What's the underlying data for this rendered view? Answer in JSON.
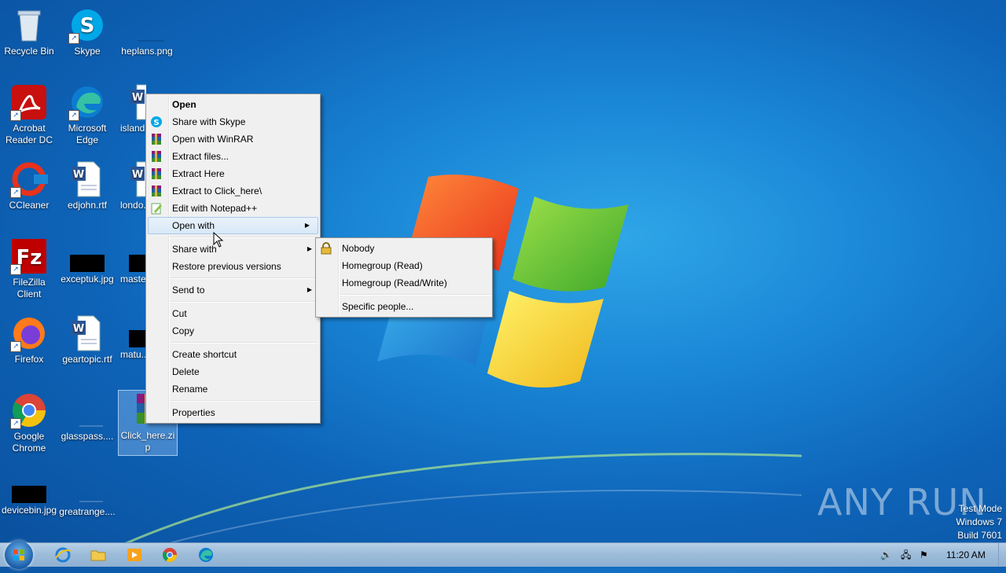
{
  "desktop": {
    "icons": [
      {
        "label": "Recycle Bin"
      },
      {
        "label": "Skype"
      },
      {
        "label": "heplans.png"
      },
      {
        "label": "Acrobat Reader DC"
      },
      {
        "label": "Microsoft Edge"
      },
      {
        "label": "island..."
      },
      {
        "label": "CCleaner"
      },
      {
        "label": "edjohn.rtf"
      },
      {
        "label": "londo..."
      },
      {
        "label": "FileZilla Client"
      },
      {
        "label": "exceptuk.jpg"
      },
      {
        "label": "maste..."
      },
      {
        "label": "Firefox"
      },
      {
        "label": "geartopic.rtf"
      },
      {
        "label": "matu..."
      },
      {
        "label": "Google Chrome"
      },
      {
        "label": "glasspass...."
      },
      {
        "label": "Click_here.zip"
      },
      {
        "label": "devicebin.jpg"
      },
      {
        "label": "greatrange...."
      }
    ]
  },
  "context_menu": {
    "items": [
      {
        "label": "Open",
        "icon": "none"
      },
      {
        "label": "Share with Skype",
        "icon": "skype-icon"
      },
      {
        "label": "Open with WinRAR",
        "icon": "winrar-icon"
      },
      {
        "label": "Extract files...",
        "icon": "winrar-icon"
      },
      {
        "label": "Extract Here",
        "icon": "winrar-icon"
      },
      {
        "label": "Extract to Click_here\\",
        "icon": "winrar-icon"
      },
      {
        "label": "Edit with Notepad++",
        "icon": "notepadpp-icon"
      },
      {
        "label": "Open with"
      },
      {
        "label": "Share with"
      },
      {
        "label": "Restore previous versions"
      },
      {
        "label": "Send to"
      },
      {
        "label": "Cut"
      },
      {
        "label": "Copy"
      },
      {
        "label": "Create shortcut"
      },
      {
        "label": "Delete"
      },
      {
        "label": "Rename"
      },
      {
        "label": "Properties"
      }
    ]
  },
  "share_submenu": {
    "items": [
      {
        "label": "Nobody",
        "icon": "lock-icon"
      },
      {
        "label": "Homegroup (Read)"
      },
      {
        "label": "Homegroup (Read/Write)"
      },
      {
        "label": "Specific people..."
      }
    ]
  },
  "taskbar": {
    "clock": "11:20 AM"
  },
  "watermark": {
    "text": "ANY RUN",
    "test_mode": "Test Mode",
    "os": "Windows 7",
    "build": "Build 7601"
  }
}
